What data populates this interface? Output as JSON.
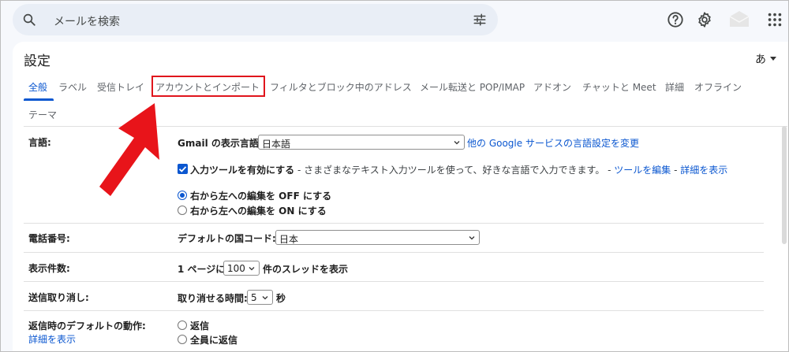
{
  "search": {
    "placeholder": "メールを検索"
  },
  "settings": {
    "title": "設定",
    "input_language_button": "あ"
  },
  "tabs": [
    {
      "label": "全般",
      "active": true
    },
    {
      "label": "ラベル"
    },
    {
      "label": "受信トレイ"
    },
    {
      "label": "アカウントとインポート",
      "highlighted": true
    },
    {
      "label": "フィルタとブロック中のアドレス"
    },
    {
      "label": "メール転送と POP/IMAP"
    },
    {
      "label": "アドオン"
    },
    {
      "label": "チャットと Meet"
    },
    {
      "label": "詳細"
    },
    {
      "label": "オフライン"
    },
    {
      "label": "テーマ"
    }
  ],
  "sections": {
    "language": {
      "label": "言語:",
      "display_label": "Gmail の表示言語:",
      "display_value": "日本語",
      "other_link": "他の Google サービスの言語設定を変更",
      "input_tools_label": "入力ツールを有効にする",
      "input_tools_desc": " - さまざまなテキスト入力ツールを使って、好きな言語で入力できます。 - ",
      "edit_tools_link": "ツールを編集",
      "sep": " - ",
      "details_link": "詳細を表示",
      "rtl_off": "右から左への編集を OFF にする",
      "rtl_on": "右から左への編集を ON にする"
    },
    "phone": {
      "label": "電話番号:",
      "country_label": "デフォルトの国コード:",
      "country_value": "日本"
    },
    "page_size": {
      "label": "表示件数:",
      "prefix": "1 ページに",
      "value": "100",
      "suffix": "件のスレッドを表示"
    },
    "undo_send": {
      "label": "送信取り消し:",
      "prefix": "取り消せる時間:",
      "value": "5",
      "suffix": "秒"
    },
    "reply_default": {
      "label": "返信時のデフォルトの動作:",
      "details_link": "詳細を表示",
      "reply": "返信",
      "reply_all": "全員に返信"
    }
  },
  "colors": {
    "accent": "#0b57d0",
    "highlight": "#e0151c",
    "arrow": "#e8141a"
  }
}
